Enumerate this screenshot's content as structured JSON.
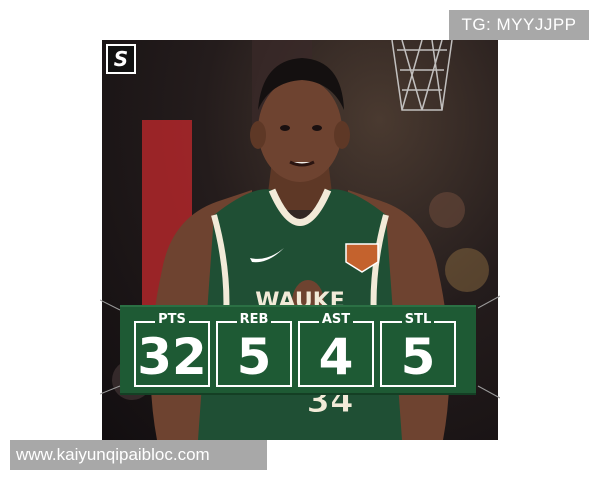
{
  "watermark_top": "TG: MYYJJPP",
  "watermark_bottom": "www.kaiyunqipaibloc.com",
  "logo_letter": "S",
  "jersey_text": "WAUKE",
  "jersey_number": "34",
  "stats": [
    {
      "label": "PTS",
      "value": "32"
    },
    {
      "label": "REB",
      "value": "5"
    },
    {
      "label": "AST",
      "value": "4"
    },
    {
      "label": "STL",
      "value": "5"
    }
  ],
  "colors": {
    "banner_green": "#1e5a34",
    "jersey_green": "#1f4f34",
    "watermark_bg": "#a8a8a8"
  }
}
